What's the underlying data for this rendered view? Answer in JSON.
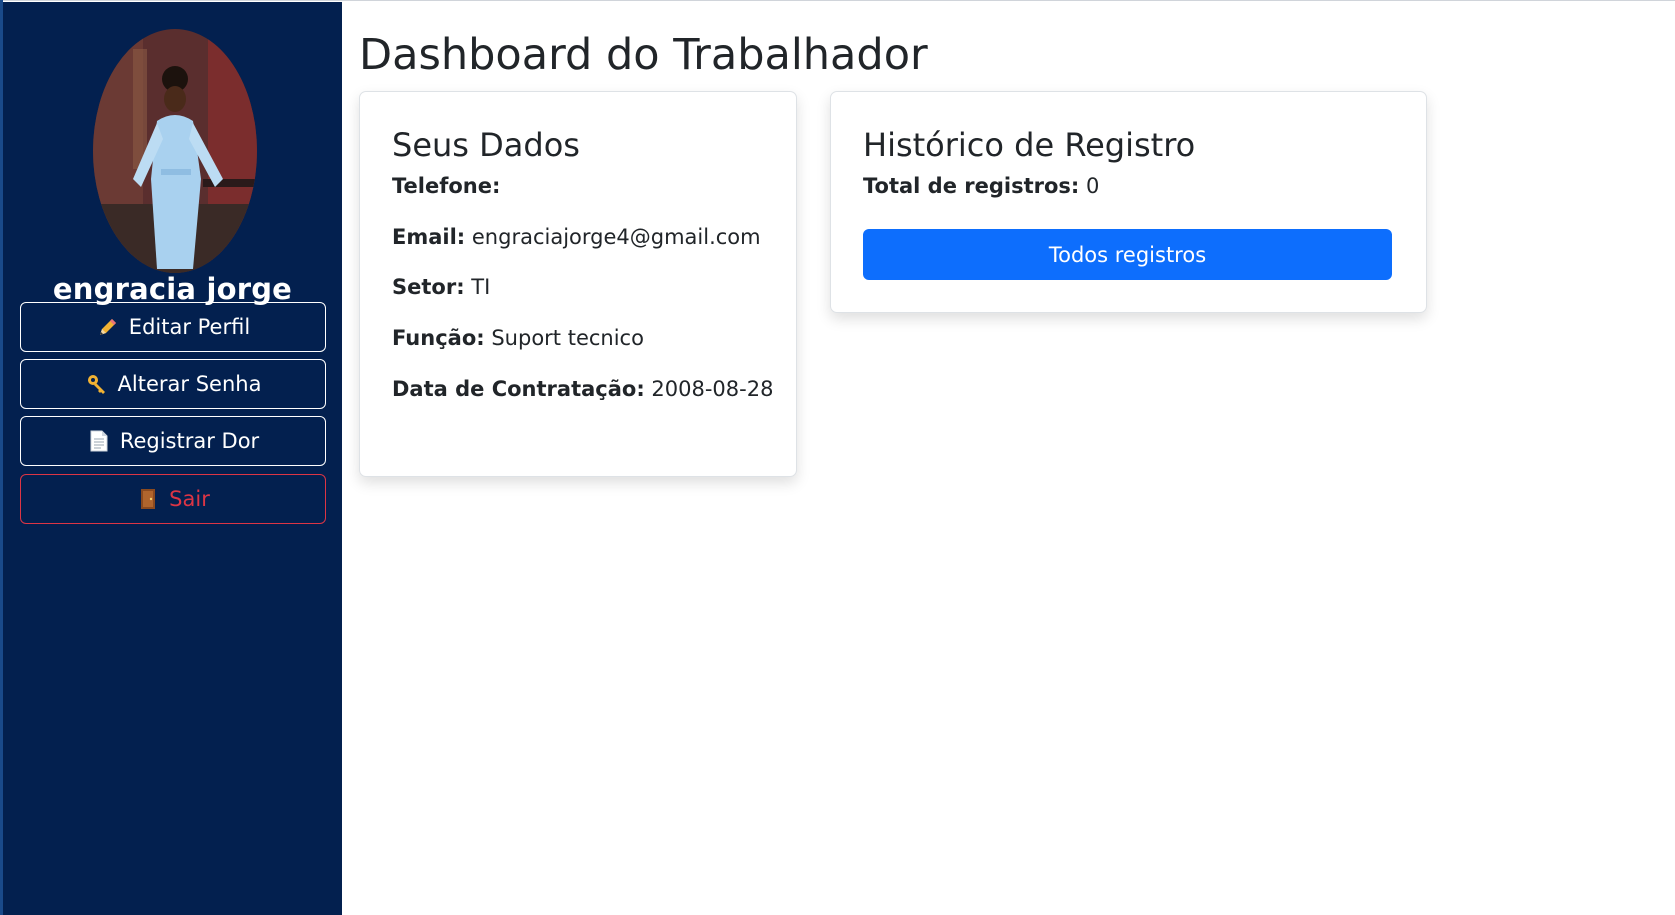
{
  "sidebar": {
    "user_name": "engracia jorge",
    "buttons": [
      {
        "label": "Editar Perfil",
        "icon": "pencil-icon"
      },
      {
        "label": "Alterar Senha",
        "icon": "key-icon"
      },
      {
        "label": "Registrar Dor",
        "icon": "document-icon"
      },
      {
        "label": "Sair",
        "icon": "door-icon"
      }
    ],
    "background": "#03204f"
  },
  "main": {
    "title": "Dashboard do Trabalhador",
    "dados": {
      "title": "Seus Dados",
      "fields": [
        {
          "label": "Telefone:",
          "value": ""
        },
        {
          "label": "Email:",
          "value": "engraciajorge4@gmail.com"
        },
        {
          "label": "Setor:",
          "value": "TI"
        },
        {
          "label": "Função:",
          "value": "Suport tecnico"
        },
        {
          "label": "Data de Contratação:",
          "value": "2008-08-28"
        }
      ]
    },
    "historico": {
      "title": "Histórico de Registro",
      "total_label": "Total de registros:",
      "total_value": "0",
      "button_label": "Todos registros"
    }
  },
  "colors": {
    "primary": "#0d6efd",
    "danger": "#dc3545",
    "sidebar": "#03204f"
  }
}
